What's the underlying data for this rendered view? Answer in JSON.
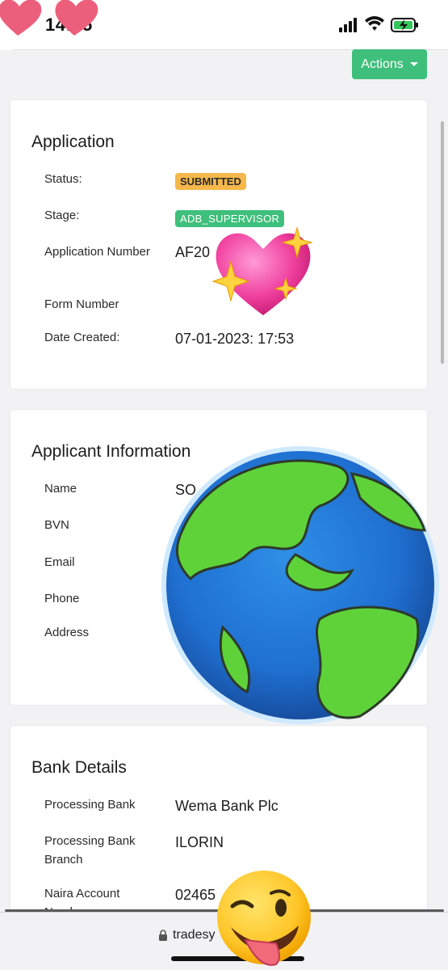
{
  "status_bar": {
    "time": "14:05"
  },
  "header": {
    "actions_label": "Actions"
  },
  "application": {
    "title": "Application",
    "status_label": "Status:",
    "status_value": "SUBMITTED",
    "stage_label": "Stage:",
    "stage_value": "ADB_SUPERVISOR",
    "app_number_label": "Application Number",
    "app_number_value": "AF20",
    "form_number_label": "Form Number",
    "date_label": "Date Created:",
    "date_value": "07-01-2023: 17:53"
  },
  "applicant": {
    "title": "Applicant Information",
    "name_label": "Name",
    "name_value": "SO",
    "bvn_label": "BVN",
    "email_label": "Email",
    "phone_label": "Phone",
    "address_label": "Address"
  },
  "bank": {
    "title": "Bank Details",
    "processing_bank_label": "Processing Bank",
    "processing_bank_value": "Wema Bank Plc",
    "branch_label": "Processing Bank Branch",
    "branch_value": "ILORIN",
    "naira_label": "Naira Account Number",
    "naira_value": "02465"
  },
  "browser": {
    "url": "tradesy"
  },
  "colors": {
    "accent_green": "#3ebf7b",
    "submitted_badge": "#f7b84b"
  }
}
